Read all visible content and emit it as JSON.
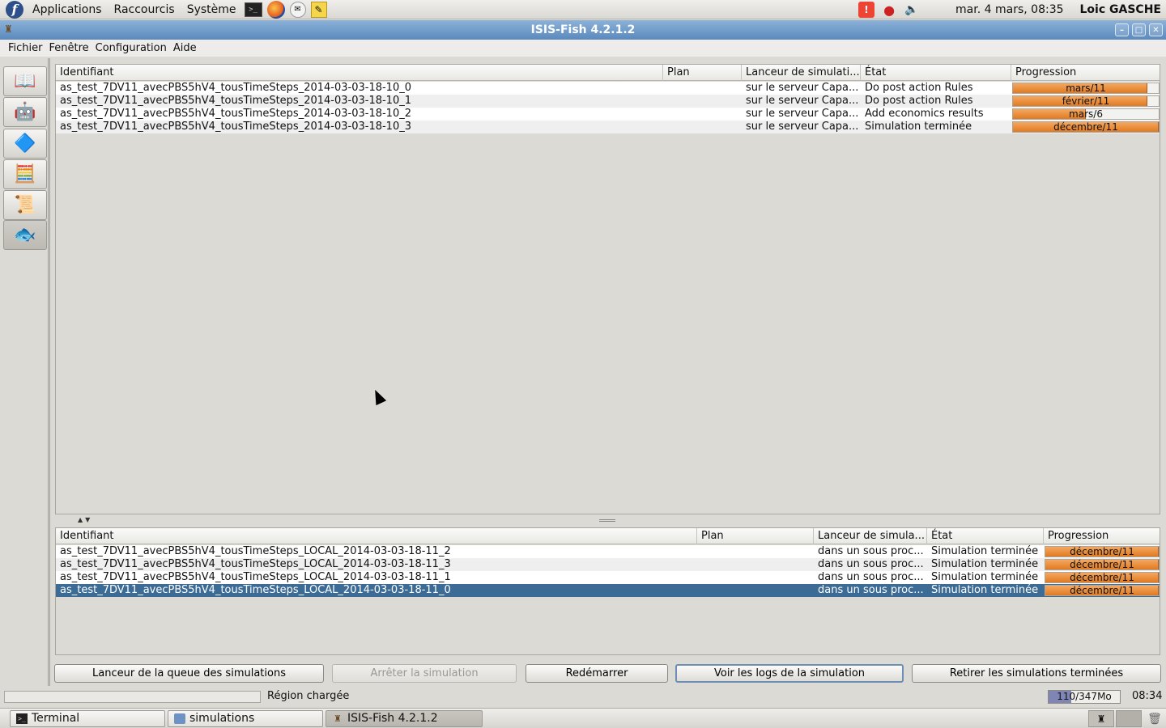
{
  "top_panel": {
    "menus": [
      "Applications",
      "Raccourcis",
      "Système"
    ],
    "clock": "mar.  4 mars, 08:35",
    "user": "Loic GASCHE"
  },
  "window": {
    "title": "ISIS-Fish 4.2.1.2",
    "menu": [
      "Fichier",
      "Fenêtre",
      "Configuration",
      "Aide"
    ]
  },
  "toolbar_icons": [
    "book-icon",
    "robot-icon",
    "spinning-top-icon",
    "calculator-icon",
    "document-icon",
    "fish-icon"
  ],
  "top_table": {
    "headers": [
      "Identifiant",
      "Plan",
      "Lanceur de simulati...",
      "État",
      "Progression"
    ],
    "rows": [
      {
        "id": "as_test_7DV11_avecPBS5hV4_tousTimeSteps_2014-03-03-18-10_0",
        "plan": "",
        "launcher": "sur le serveur Capa...",
        "state": "Do post action Rules",
        "progress_label": "mars/11",
        "progress": 0.92
      },
      {
        "id": "as_test_7DV11_avecPBS5hV4_tousTimeSteps_2014-03-03-18-10_1",
        "plan": "",
        "launcher": "sur le serveur Capa...",
        "state": "Do post action Rules",
        "progress_label": "février/11",
        "progress": 0.92
      },
      {
        "id": "as_test_7DV11_avecPBS5hV4_tousTimeSteps_2014-03-03-18-10_2",
        "plan": "",
        "launcher": "sur le serveur Capa...",
        "state": "Add economics results",
        "progress_label": "mars/6",
        "progress": 0.5
      },
      {
        "id": "as_test_7DV11_avecPBS5hV4_tousTimeSteps_2014-03-03-18-10_3",
        "plan": "",
        "launcher": "sur le serveur Capa...",
        "state": "Simulation terminée",
        "progress_label": "décembre/11",
        "progress": 1.0
      }
    ]
  },
  "bottom_table": {
    "headers": [
      "Identifiant",
      "Plan",
      "Lanceur de simula...",
      "État",
      "Progression"
    ],
    "rows": [
      {
        "id": "as_test_7DV11_avecPBS5hV4_tousTimeSteps_LOCAL_2014-03-03-18-11_2",
        "plan": "",
        "launcher": "dans un sous proc...",
        "state": "Simulation terminée",
        "progress_label": "décembre/11",
        "progress": 1.0
      },
      {
        "id": "as_test_7DV11_avecPBS5hV4_tousTimeSteps_LOCAL_2014-03-03-18-11_3",
        "plan": "",
        "launcher": "dans un sous proc...",
        "state": "Simulation terminée",
        "progress_label": "décembre/11",
        "progress": 1.0
      },
      {
        "id": "as_test_7DV11_avecPBS5hV4_tousTimeSteps_LOCAL_2014-03-03-18-11_1",
        "plan": "",
        "launcher": "dans un sous proc...",
        "state": "Simulation terminée",
        "progress_label": "décembre/11",
        "progress": 1.0
      },
      {
        "id": "as_test_7DV11_avecPBS5hV4_tousTimeSteps_LOCAL_2014-03-03-18-11_0",
        "plan": "",
        "launcher": "dans un sous proc...",
        "state": "Simulation terminée",
        "progress_label": "décembre/11",
        "progress": 1.0,
        "selected": true
      }
    ]
  },
  "buttons": {
    "queue_launcher": "Lanceur de la queue des simulations",
    "stop": "Arrêter la simulation",
    "restart": "Redémarrer",
    "view_logs": "Voir les logs de la simulation",
    "remove_finished": "Retirer les simulations terminées"
  },
  "status": {
    "text": "Région chargée",
    "memory": "110/347Mo",
    "memory_used_fraction": 0.32,
    "time": "08:34"
  },
  "taskbar": {
    "tasks": [
      "Terminal",
      "simulations",
      "ISIS-Fish 4.2.1.2"
    ]
  }
}
